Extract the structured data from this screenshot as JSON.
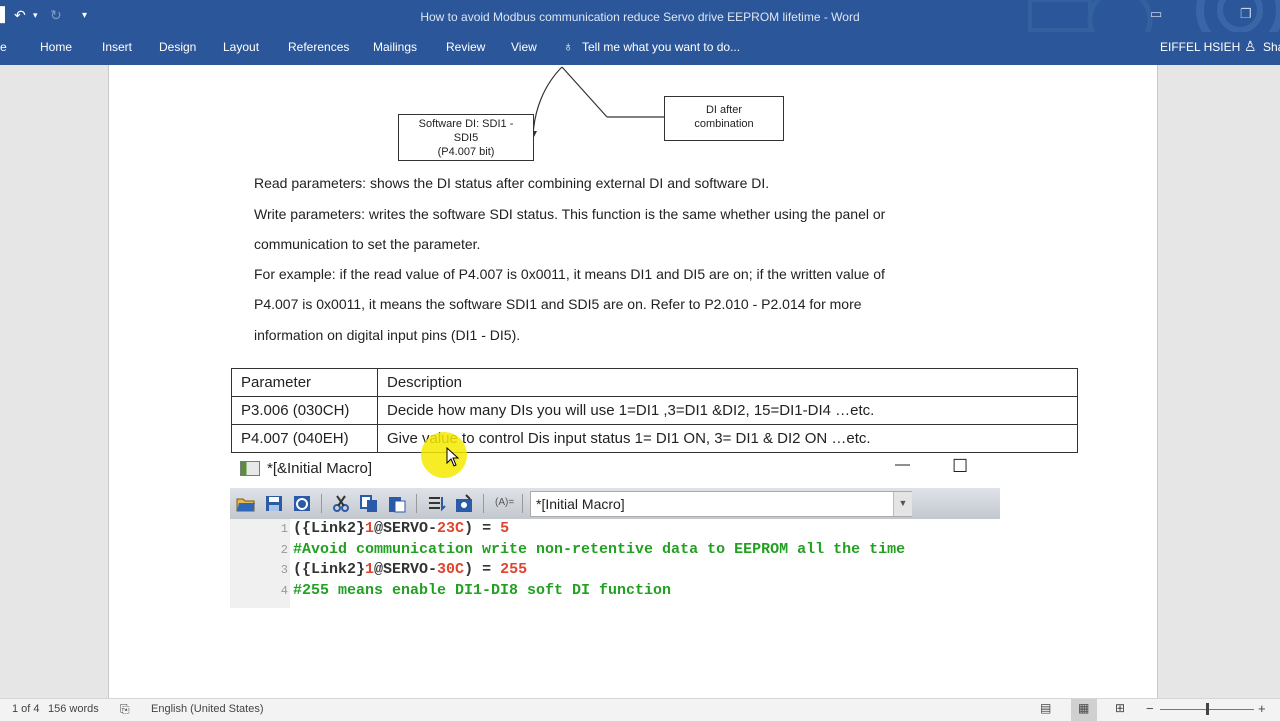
{
  "window": {
    "title": "How to avoid Modbus communication reduce Servo drive EEPROM lifetime - Word",
    "user": "EIFFEL HSIEH",
    "share": "Sha"
  },
  "ribbon": {
    "tabs": [
      "e",
      "Home",
      "Insert",
      "Design",
      "Layout",
      "References",
      "Mailings",
      "Review",
      "View"
    ],
    "tell_me": "Tell me what you want to do..."
  },
  "document": {
    "diagram": {
      "software_di_box": [
        "Software DI: SDI1 -",
        "SDI5",
        "(P4.007 bit)"
      ],
      "di_after_box": [
        "DI after",
        "combination"
      ]
    },
    "paragraphs": [
      "Read parameters: shows the DI status after combining external DI and software DI.",
      "Write parameters: writes the software SDI status. This function is the same whether using the panel or",
      "communication to set the parameter.",
      "For example: if the read value of P4.007 is 0x0011, it means DI1 and DI5 are on; if the written value of",
      "P4.007 is 0x0011, it means the software SDI1 and SDI5 are on. Refer to P2.010 - P2.014 for more",
      "information on digital input pins (DI1 - DI5)."
    ],
    "table": {
      "headers": [
        "Parameter",
        "Description"
      ],
      "rows": [
        [
          "P3.006 (030CH)",
          "Decide how many DIs you will use  1=DI1 ,3=DI1 &DI2, 15=DI1-DI4 …etc."
        ],
        [
          "P4.007 (040EH)",
          "Give value to control Dis input status 1= DI1 ON, 3= DI1 & DI2 ON …etc."
        ]
      ]
    }
  },
  "macro": {
    "title": "*[&Initial Macro]",
    "minimize": "—",
    "maximize": "☐",
    "dropdown_value": "*[Initial Macro]",
    "toolbar_label": "(A)=",
    "lines": [
      {
        "num": "1",
        "parts": [
          {
            "t": "({Link2}",
            "c": "#333333"
          },
          {
            "t": "1",
            "c": "#e0442c"
          },
          {
            "t": "@SERVO-",
            "c": "#333333"
          },
          {
            "t": "23C",
            "c": "#e0442c"
          },
          {
            "t": ") = ",
            "c": "#333333"
          },
          {
            "t": "5",
            "c": "#e0442c"
          }
        ]
      },
      {
        "num": "2",
        "parts": [
          {
            "t": "#Avoid communication write non-retentive data to EEPROM all the time",
            "c": "#22a022"
          }
        ]
      },
      {
        "num": "3",
        "parts": [
          {
            "t": "({Link2}",
            "c": "#333333"
          },
          {
            "t": "1",
            "c": "#e0442c"
          },
          {
            "t": "@SERVO-",
            "c": "#333333"
          },
          {
            "t": "30C",
            "c": "#e0442c"
          },
          {
            "t": ") = ",
            "c": "#333333"
          },
          {
            "t": "255",
            "c": "#e0442c"
          }
        ]
      },
      {
        "num": "4",
        "parts": [
          {
            "t": "#255 means enable DI1-DI8 soft DI function",
            "c": "#22a022"
          }
        ]
      }
    ]
  },
  "status": {
    "page": "1 of 4",
    "words": "156 words",
    "language": "English (United States)"
  },
  "colors": {
    "word_blue": "#2b579a",
    "comment_green": "#22a022",
    "number_red": "#e0442c",
    "cursor_highlight": "#f5ea00"
  }
}
